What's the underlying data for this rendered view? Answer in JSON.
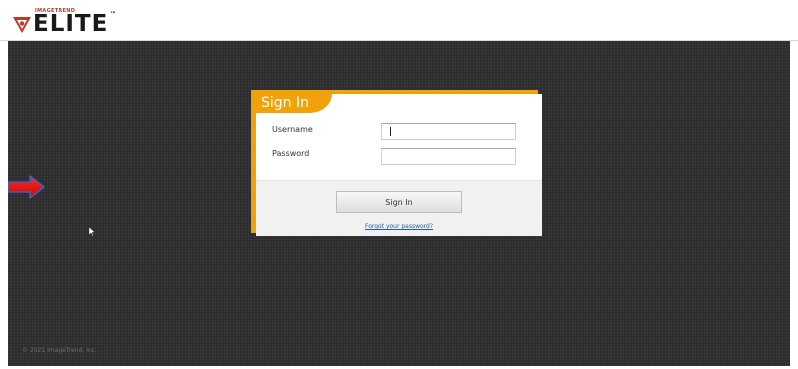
{
  "header": {
    "logo_small": "IMAGETREND",
    "logo_text": "ELITE",
    "logo_tm": "™"
  },
  "login": {
    "title": "Sign In",
    "username_label": "Username",
    "username_value": "",
    "password_label": "Password",
    "password_value": "",
    "submit_label": "Sign In",
    "forgot_link": "Forgot your password?"
  },
  "footer": {
    "copyright": "© 2021 ImageTrend, Inc."
  },
  "colors": {
    "accent": "#f0a20b",
    "background": "#2c2c2c",
    "link": "#1f5fa8",
    "annotation_arrow": "#e01010"
  },
  "icons": {
    "logo_emblem": "imagetrend-emblem",
    "annotation": "red-arrow-right",
    "pointer": "mouse-cursor"
  }
}
